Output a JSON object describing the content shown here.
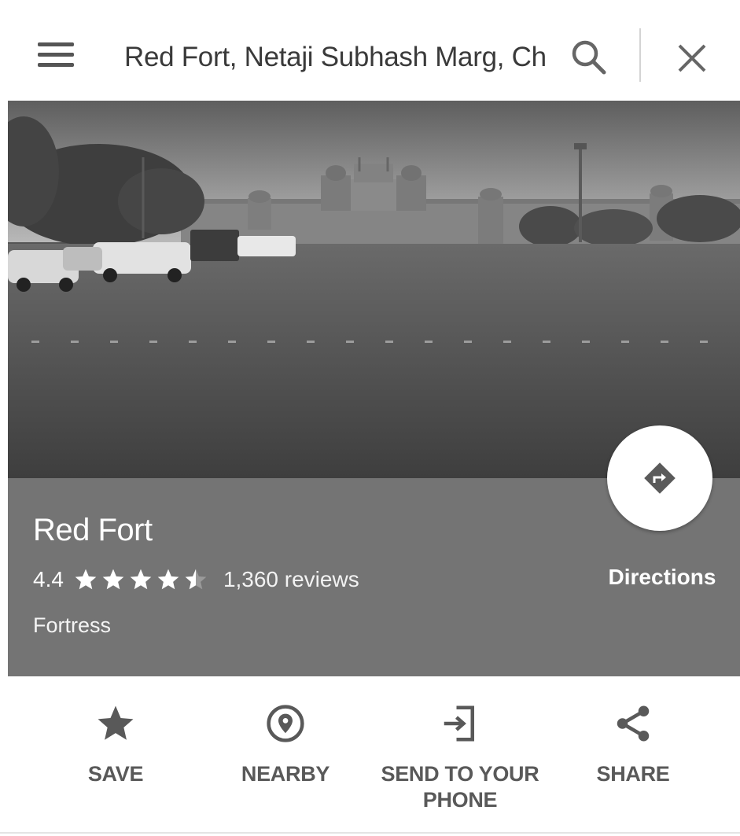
{
  "search": {
    "query": "Red Fort, Netaji Subhash Marg, Ch",
    "menu_icon": "hamburger-menu-icon",
    "search_icon": "search-icon",
    "close_icon": "close-icon"
  },
  "place": {
    "name": "Red Fort",
    "rating": "4.4",
    "rating_stars": 4.4,
    "reviews": "1,360 reviews",
    "category": "Fortress"
  },
  "directions": {
    "label": "Directions",
    "icon": "directions-icon"
  },
  "actions": [
    {
      "label": "SAVE",
      "icon": "star-icon"
    },
    {
      "label": "NEARBY",
      "icon": "nearby-pin-icon"
    },
    {
      "label": "SEND TO YOUR PHONE",
      "icon": "send-to-phone-icon"
    },
    {
      "label": "SHARE",
      "icon": "share-icon"
    }
  ],
  "colors": {
    "panel": "#747474",
    "icon": "#595959"
  }
}
